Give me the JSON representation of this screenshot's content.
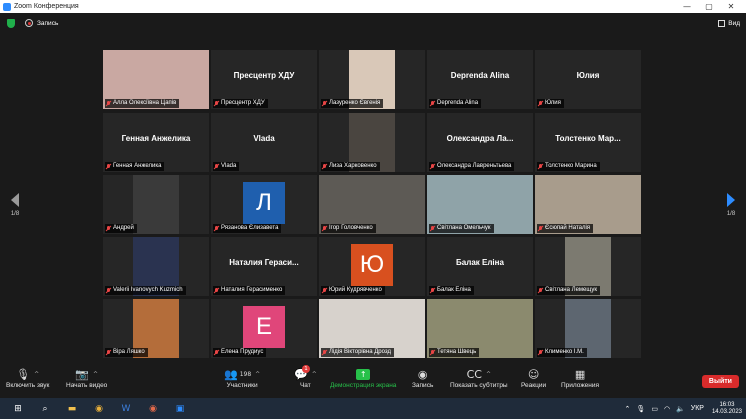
{
  "window": {
    "title": "Zoom Конференция",
    "controls": [
      "—",
      "▢",
      "✕"
    ]
  },
  "topbar": {
    "recording_label": "Запись",
    "view_label": "Вид"
  },
  "pagination": {
    "left": "1/8",
    "right": "1/8"
  },
  "tiles": [
    {
      "label": "Алла Олексіївна Цапів",
      "big": "",
      "kind": "photo",
      "color": "#c9a8a2",
      "active": true
    },
    {
      "label": "Пресцентр ХДУ",
      "big": "Пресцентр ХДУ",
      "kind": "name"
    },
    {
      "label": "Лазуренко Євгенія",
      "big": "",
      "kind": "photo-small",
      "color": "#d9c8b8"
    },
    {
      "label": "Deprenda Alina",
      "big": "Deprenda Alina",
      "kind": "name"
    },
    {
      "label": "Юлия",
      "big": "Юлия",
      "kind": "name"
    },
    {
      "label": "Генная Анжелика",
      "big": "Генная Анжелика",
      "kind": "name"
    },
    {
      "label": "Vlada",
      "big": "Vlada",
      "kind": "name"
    },
    {
      "label": "Лиза Харковенко",
      "big": "",
      "kind": "photo-small",
      "color": "#4a4540"
    },
    {
      "label": "Олександра Лавреньтьева",
      "big": "Олександра Ла...",
      "kind": "name"
    },
    {
      "label": "Толстенко Марина",
      "big": "Толстенко Мар...",
      "kind": "name"
    },
    {
      "label": "Андрей",
      "big": "",
      "kind": "photo-small",
      "color": "#3a3a3a"
    },
    {
      "label": "Рязанова Єлизавета",
      "big": "",
      "kind": "avatar",
      "letter": "Л",
      "color": "#1f5fae"
    },
    {
      "label": "Ігор Головченко",
      "big": "",
      "kind": "photo",
      "color": "#5d5a55"
    },
    {
      "label": "Світлана Омельчук",
      "big": "",
      "kind": "photo",
      "color": "#8fa3a8"
    },
    {
      "label": "Єсюпай Наталія",
      "big": "",
      "kind": "photo",
      "color": "#a89c8c"
    },
    {
      "label": "Valerii Ivanovych Kuzmich",
      "big": "",
      "kind": "photo-small",
      "color": "#2a3350"
    },
    {
      "label": "Наталия Герасименко",
      "big": "Наталия Гераси...",
      "kind": "name"
    },
    {
      "label": "Юрий Кудрявченко",
      "big": "",
      "kind": "avatar",
      "letter": "Ю",
      "color": "#d8501f"
    },
    {
      "label": "Балак Еліна",
      "big": "Балак Еліна",
      "kind": "name"
    },
    {
      "label": "Світлана Лемещук",
      "big": "",
      "kind": "photo-small",
      "color": "#7c7a70"
    },
    {
      "label": "Віра Ляшко",
      "big": "",
      "kind": "photo-small",
      "color": "#b46d3a"
    },
    {
      "label": "Елена Прудиус",
      "big": "",
      "kind": "avatar",
      "letter": "Е",
      "color": "#e0467a"
    },
    {
      "label": "Лідія Вікторівна Дрозд",
      "big": "",
      "kind": "photo",
      "color": "#d7d2cc"
    },
    {
      "label": "Тетяна Швець",
      "big": "",
      "kind": "photo",
      "color": "#8b8a6e"
    },
    {
      "label": "Клименко І.М.",
      "big": "",
      "kind": "photo-small",
      "color": "#5d6670"
    }
  ],
  "toolbar": {
    "audio": "Включить звук",
    "video": "Начать видео",
    "participants": "Участники",
    "participants_count": "198",
    "chat": "Чат",
    "chat_badge": "1",
    "share": "Демонстрация экрана",
    "record": "Запись",
    "captions": "Показать субтитры",
    "reactions": "Реакции",
    "apps": "Приложения",
    "leave": "Выйти"
  },
  "taskbar": {
    "lang": "УКР",
    "time": "16:03",
    "date": "14.03.2023"
  },
  "colors": {
    "accent": "#2d8cff",
    "active_border": "#b6d93c",
    "leave": "#d92b2b",
    "share": "#27c14a"
  }
}
